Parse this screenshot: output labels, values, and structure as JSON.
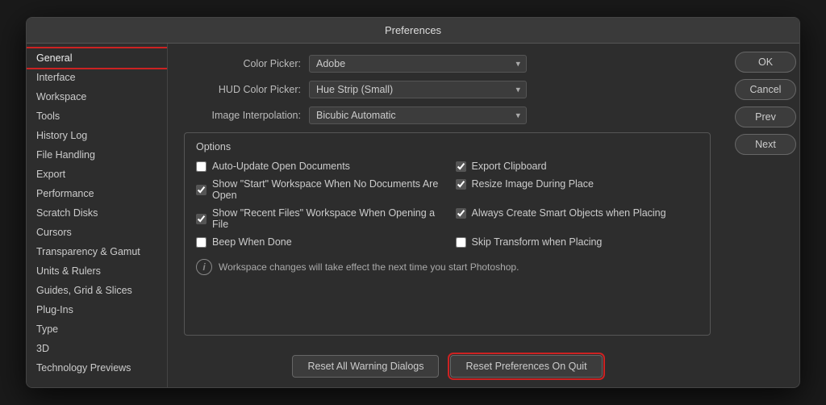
{
  "dialog": {
    "title": "Preferences"
  },
  "sidebar": {
    "items": [
      {
        "label": "General",
        "active": true
      },
      {
        "label": "Interface",
        "active": false
      },
      {
        "label": "Workspace",
        "active": false
      },
      {
        "label": "Tools",
        "active": false
      },
      {
        "label": "History Log",
        "active": false
      },
      {
        "label": "File Handling",
        "active": false
      },
      {
        "label": "Export",
        "active": false
      },
      {
        "label": "Performance",
        "active": false
      },
      {
        "label": "Scratch Disks",
        "active": false
      },
      {
        "label": "Cursors",
        "active": false
      },
      {
        "label": "Transparency & Gamut",
        "active": false
      },
      {
        "label": "Units & Rulers",
        "active": false
      },
      {
        "label": "Guides, Grid & Slices",
        "active": false
      },
      {
        "label": "Plug-Ins",
        "active": false
      },
      {
        "label": "Type",
        "active": false
      },
      {
        "label": "3D",
        "active": false
      },
      {
        "label": "Technology Previews",
        "active": false
      }
    ]
  },
  "fields": {
    "color_picker_label": "Color Picker:",
    "color_picker_value": "Adobe",
    "hud_color_picker_label": "HUD Color Picker:",
    "hud_color_picker_value": "Hue Strip (Small)",
    "image_interpolation_label": "Image Interpolation:",
    "image_interpolation_value": "Bicubic Automatic"
  },
  "options": {
    "title": "Options",
    "checkboxes": [
      {
        "label": "Auto-Update Open Documents",
        "checked": false,
        "col": 0
      },
      {
        "label": "Export Clipboard",
        "checked": true,
        "col": 1
      },
      {
        "label": "Show \"Start\" Workspace When No Documents Are Open",
        "checked": true,
        "col": 0
      },
      {
        "label": "Resize Image During Place",
        "checked": true,
        "col": 1
      },
      {
        "label": "Show \"Recent Files\" Workspace When Opening a File",
        "checked": true,
        "col": 0
      },
      {
        "label": "Always Create Smart Objects when Placing",
        "checked": true,
        "col": 1
      },
      {
        "label": "Beep When Done",
        "checked": false,
        "col": 0
      },
      {
        "label": "Skip Transform when Placing",
        "checked": false,
        "col": 1
      }
    ],
    "info_text": "Workspace changes will take effect the next time you start Photoshop."
  },
  "buttons": {
    "ok": "OK",
    "cancel": "Cancel",
    "prev": "Prev",
    "next": "Next",
    "reset_warning": "Reset All Warning Dialogs",
    "reset_preferences": "Reset Preferences On Quit"
  }
}
